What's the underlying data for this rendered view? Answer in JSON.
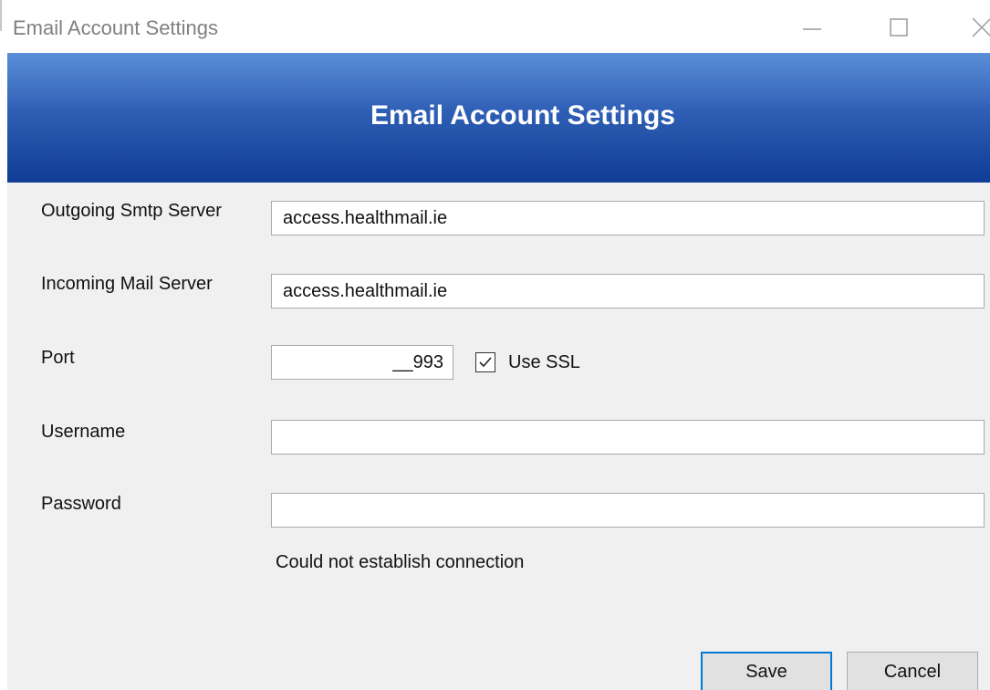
{
  "window": {
    "title": "Email Account Settings",
    "minimize_icon": "minimize-icon",
    "maximize_icon": "maximize-icon",
    "close_icon": "close-icon"
  },
  "header": {
    "title": "Email Account Settings",
    "gradient_top": "#5b8fd8",
    "gradient_bottom": "#0f3c95"
  },
  "form": {
    "smtp": {
      "label": "Outgoing Smtp Server",
      "value": "access.healthmail.ie"
    },
    "incoming": {
      "label": "Incoming Mail Server",
      "value": "access.healthmail.ie"
    },
    "port": {
      "label": "Port",
      "value": "__993"
    },
    "ssl": {
      "label": "Use SSL",
      "checked": true,
      "icon": "checkmark-icon"
    },
    "username": {
      "label": "Username",
      "value": ""
    },
    "password": {
      "label": "Password",
      "value": ""
    }
  },
  "status": "Could not establish connection",
  "buttons": {
    "save": "Save",
    "cancel": "Cancel",
    "focus_color": "#0078d7"
  }
}
